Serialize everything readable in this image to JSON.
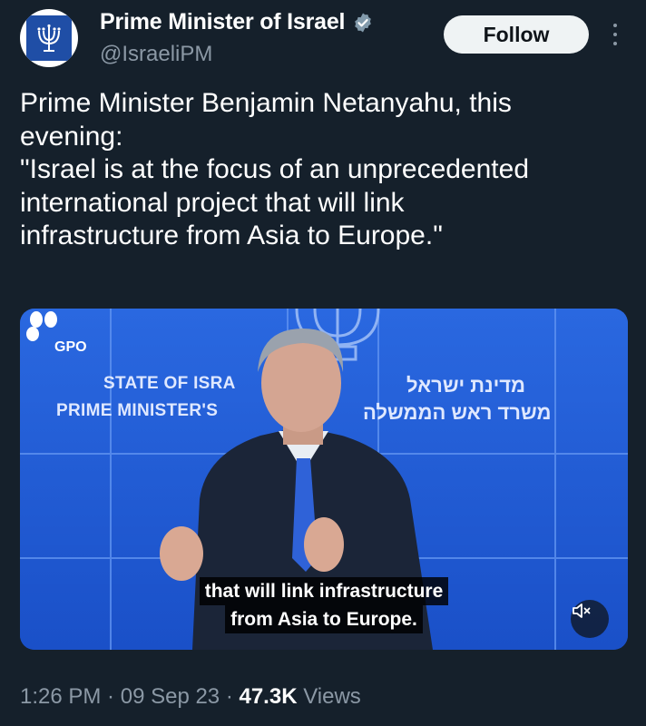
{
  "header": {
    "name": "Prime Minister of Israel",
    "handle": "@IsraeliPM",
    "follow_label": "Follow",
    "verified_icon": "verified-badge-icon",
    "accent_color": "#1d9bf0"
  },
  "tweet": {
    "lines": [
      "Prime Minister Benjamin Netanyahu, this",
      "evening:",
      "\"Israel is at the focus of an unprecedented",
      "international project that will link",
      "infrastructure from Asia to Europe.\""
    ]
  },
  "media": {
    "logo_text": "GPO",
    "backdrop_en_1": "STATE OF ISRA",
    "backdrop_en_2": "PRIME MINISTER'S",
    "backdrop_he_1": "מדינת ישראל",
    "backdrop_he_2": "משרד ראש הממשלה",
    "caption_line_1": "that will link infrastructure",
    "caption_line_2": "from Asia to Europe.",
    "mute_icon": "volume-muted-icon"
  },
  "meta": {
    "time": "1:26 PM",
    "sep1": " · ",
    "date": "09 Sep 23",
    "sep2": " · ",
    "views_count": "47.3K",
    "views_label": " Views"
  }
}
